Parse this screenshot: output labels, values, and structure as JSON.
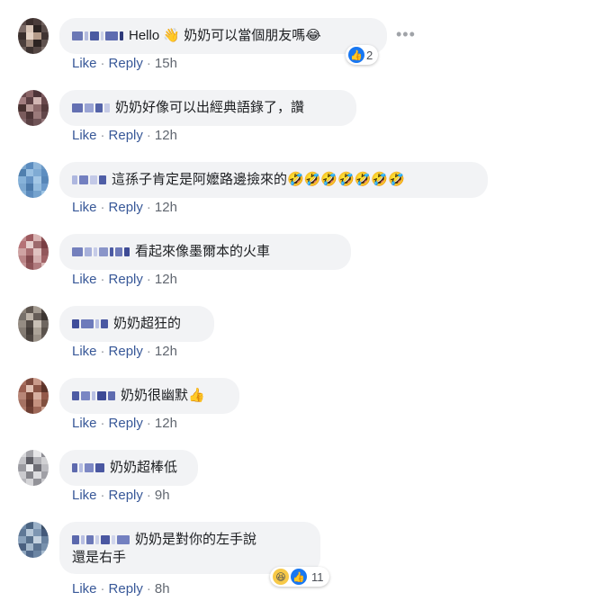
{
  "like_label": "Like",
  "reply_label": "Reply",
  "separator": "·",
  "more_options": "•••",
  "colors": {
    "link": "#385898",
    "bubble": "#f2f3f5",
    "like_blue": "#1877f2"
  },
  "comments": [
    {
      "text": "Hello 👋 奶奶可以當個朋友嗎😂",
      "time": "15h",
      "reaction_count": "2",
      "reactions": [
        "like-icon"
      ]
    },
    {
      "text": "奶奶好像可以出經典語錄了，讚",
      "time": "12h"
    },
    {
      "text": "這孫子肯定是阿嬤路邊撿來的🤣🤣🤣🤣🤣🤣🤣",
      "time": "12h"
    },
    {
      "text": "看起來像墨爾本的火車",
      "time": "12h"
    },
    {
      "text": "奶奶超狂的",
      "time": "12h"
    },
    {
      "text": "奶奶很幽默👍",
      "time": "12h"
    },
    {
      "text": "奶奶超棒低",
      "time": "9h"
    },
    {
      "text_line1": "奶奶是對你的左手說",
      "text_line2": "還是右手",
      "time": "8h",
      "reaction_count": "11",
      "reactions": [
        "haha-icon",
        "like-icon"
      ]
    }
  ]
}
